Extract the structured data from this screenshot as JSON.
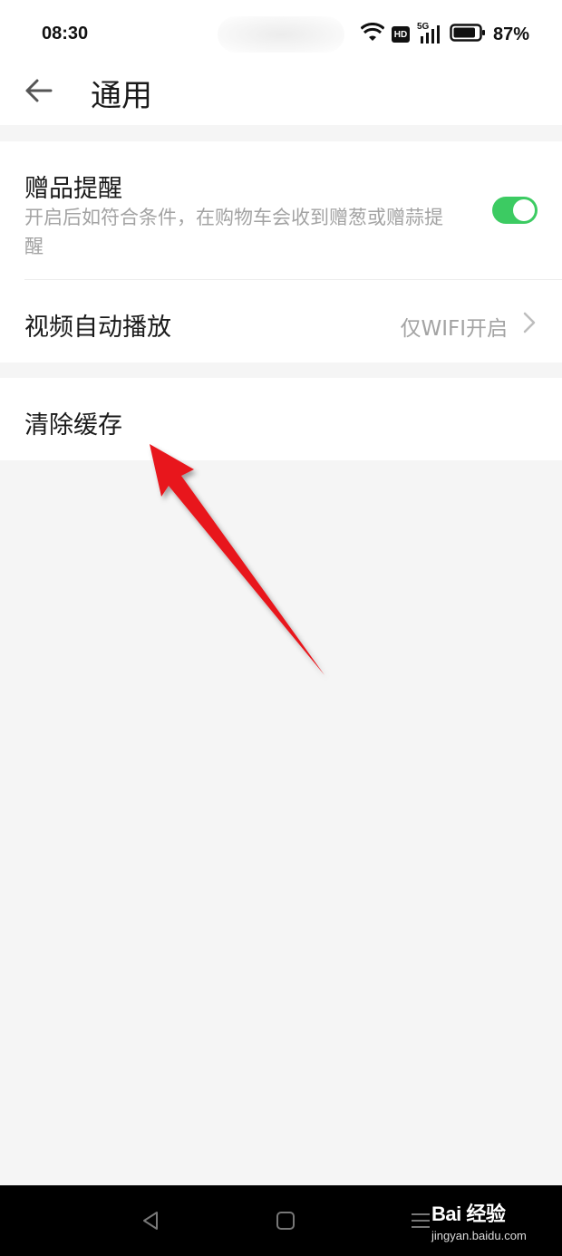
{
  "status_bar": {
    "time": "08:30",
    "hd_label": "HD",
    "network_label": "5G",
    "battery_percent": "87%",
    "battery_level": 0.87
  },
  "header": {
    "title": "通用"
  },
  "settings": {
    "gift_reminder": {
      "title": "赠品提醒",
      "description": "开启后如符合条件，在购物车会收到赠葱或赠蒜提醒",
      "enabled": true
    },
    "video_autoplay": {
      "title": "视频自动播放",
      "value": "仅WIFI开启"
    },
    "clear_cache": {
      "title": "清除缓存"
    }
  },
  "watermark": {
    "brand": "Bai 经验",
    "url": "jingyan.baidu.com"
  },
  "colors": {
    "toggle_on": "#3ccb62",
    "annotation_arrow": "#e8141a",
    "background": "#f5f5f5"
  }
}
